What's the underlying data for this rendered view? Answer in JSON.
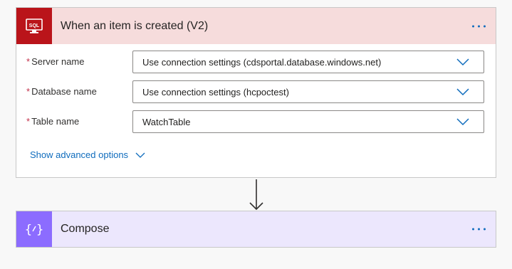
{
  "trigger": {
    "title": "When an item is created (V2)",
    "icon": "sql-icon",
    "icon_text": "SQL",
    "accent": "#ba141a",
    "header_bg": "#f6dcdc",
    "fields": [
      {
        "label": "Server name",
        "required_mark": "*",
        "value": "Use connection settings (cdsportal.database.windows.net)"
      },
      {
        "label": "Database name",
        "required_mark": "*",
        "value": "Use connection settings (hcpoctest)"
      },
      {
        "label": "Table name",
        "required_mark": "*",
        "value": "WatchTable"
      }
    ],
    "advanced_label": "Show advanced options"
  },
  "compose": {
    "title": "Compose",
    "icon": "compose-icon",
    "accent": "#8c6cff",
    "header_bg": "#ece7fd"
  },
  "colors": {
    "link": "#0f6cbd",
    "required": "#c4314b"
  }
}
